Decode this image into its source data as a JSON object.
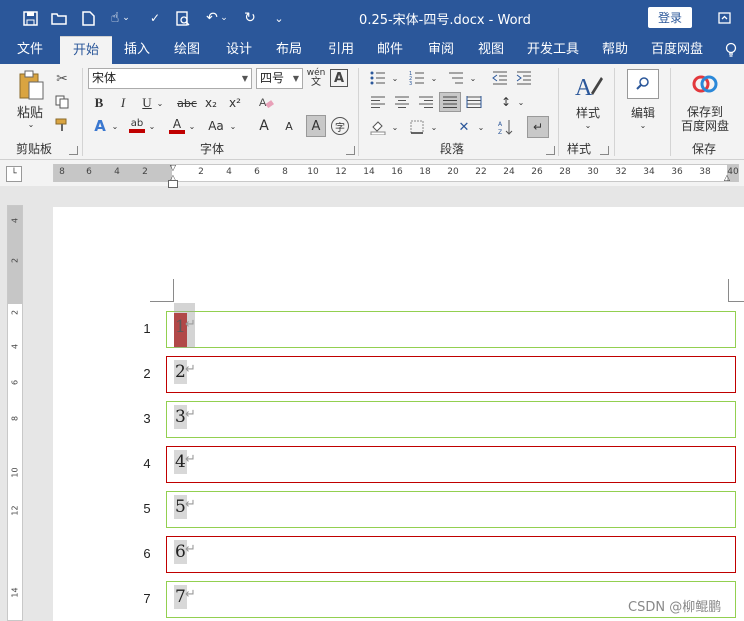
{
  "title_bar": {
    "document_title": "0.25-宋体-四号.docx  -  Word",
    "login_label": "登录",
    "qat_more": "⌄"
  },
  "tabs": [
    "文件",
    "开始",
    "插入",
    "绘图",
    "设计",
    "布局",
    "引用",
    "邮件",
    "审阅",
    "视图",
    "开发工具",
    "帮助",
    "百度网盘"
  ],
  "active_tab": "开始",
  "ribbon": {
    "clipboard": {
      "label": "剪贴板",
      "paste_label": "粘贴"
    },
    "font": {
      "label": "字体",
      "font_name": "宋体",
      "font_size": "四号",
      "phonetic": "wén",
      "bold": "B",
      "italic": "I",
      "underline": "U",
      "strike": "abc",
      "subscript": "x₂",
      "superscript": "x²",
      "change_case": "Aa",
      "grow": "A",
      "shrink": "A",
      "shade": "A",
      "enclose": "字"
    },
    "paragraph": {
      "label": "段落"
    },
    "styles": {
      "label": "样式",
      "button_label": "样式"
    },
    "editing": {
      "button_label": "编辑"
    },
    "save": {
      "label": "保存",
      "button_line1": "保存到",
      "button_line2": "百度网盘"
    }
  },
  "ruler": {
    "h_ticks": [
      "8",
      "6",
      "4",
      "2",
      "2",
      "4",
      "6",
      "8",
      "10",
      "12",
      "14",
      "16",
      "18",
      "20",
      "22",
      "24",
      "26",
      "28",
      "30",
      "32",
      "34",
      "36",
      "38",
      "40"
    ],
    "v_ticks": [
      "4",
      "2",
      "2",
      "4",
      "6",
      "8",
      "10",
      "12",
      "14"
    ]
  },
  "document": {
    "line_numbers": [
      "1",
      "2",
      "3",
      "4",
      "5",
      "6",
      "7"
    ],
    "rows": [
      "1",
      "2",
      "3",
      "4",
      "5",
      "6",
      "7"
    ],
    "paragraph_mark": "↵",
    "border_colors": [
      "#92d050",
      "#c00000"
    ]
  },
  "watermark": "CSDN @柳鲲鹏"
}
